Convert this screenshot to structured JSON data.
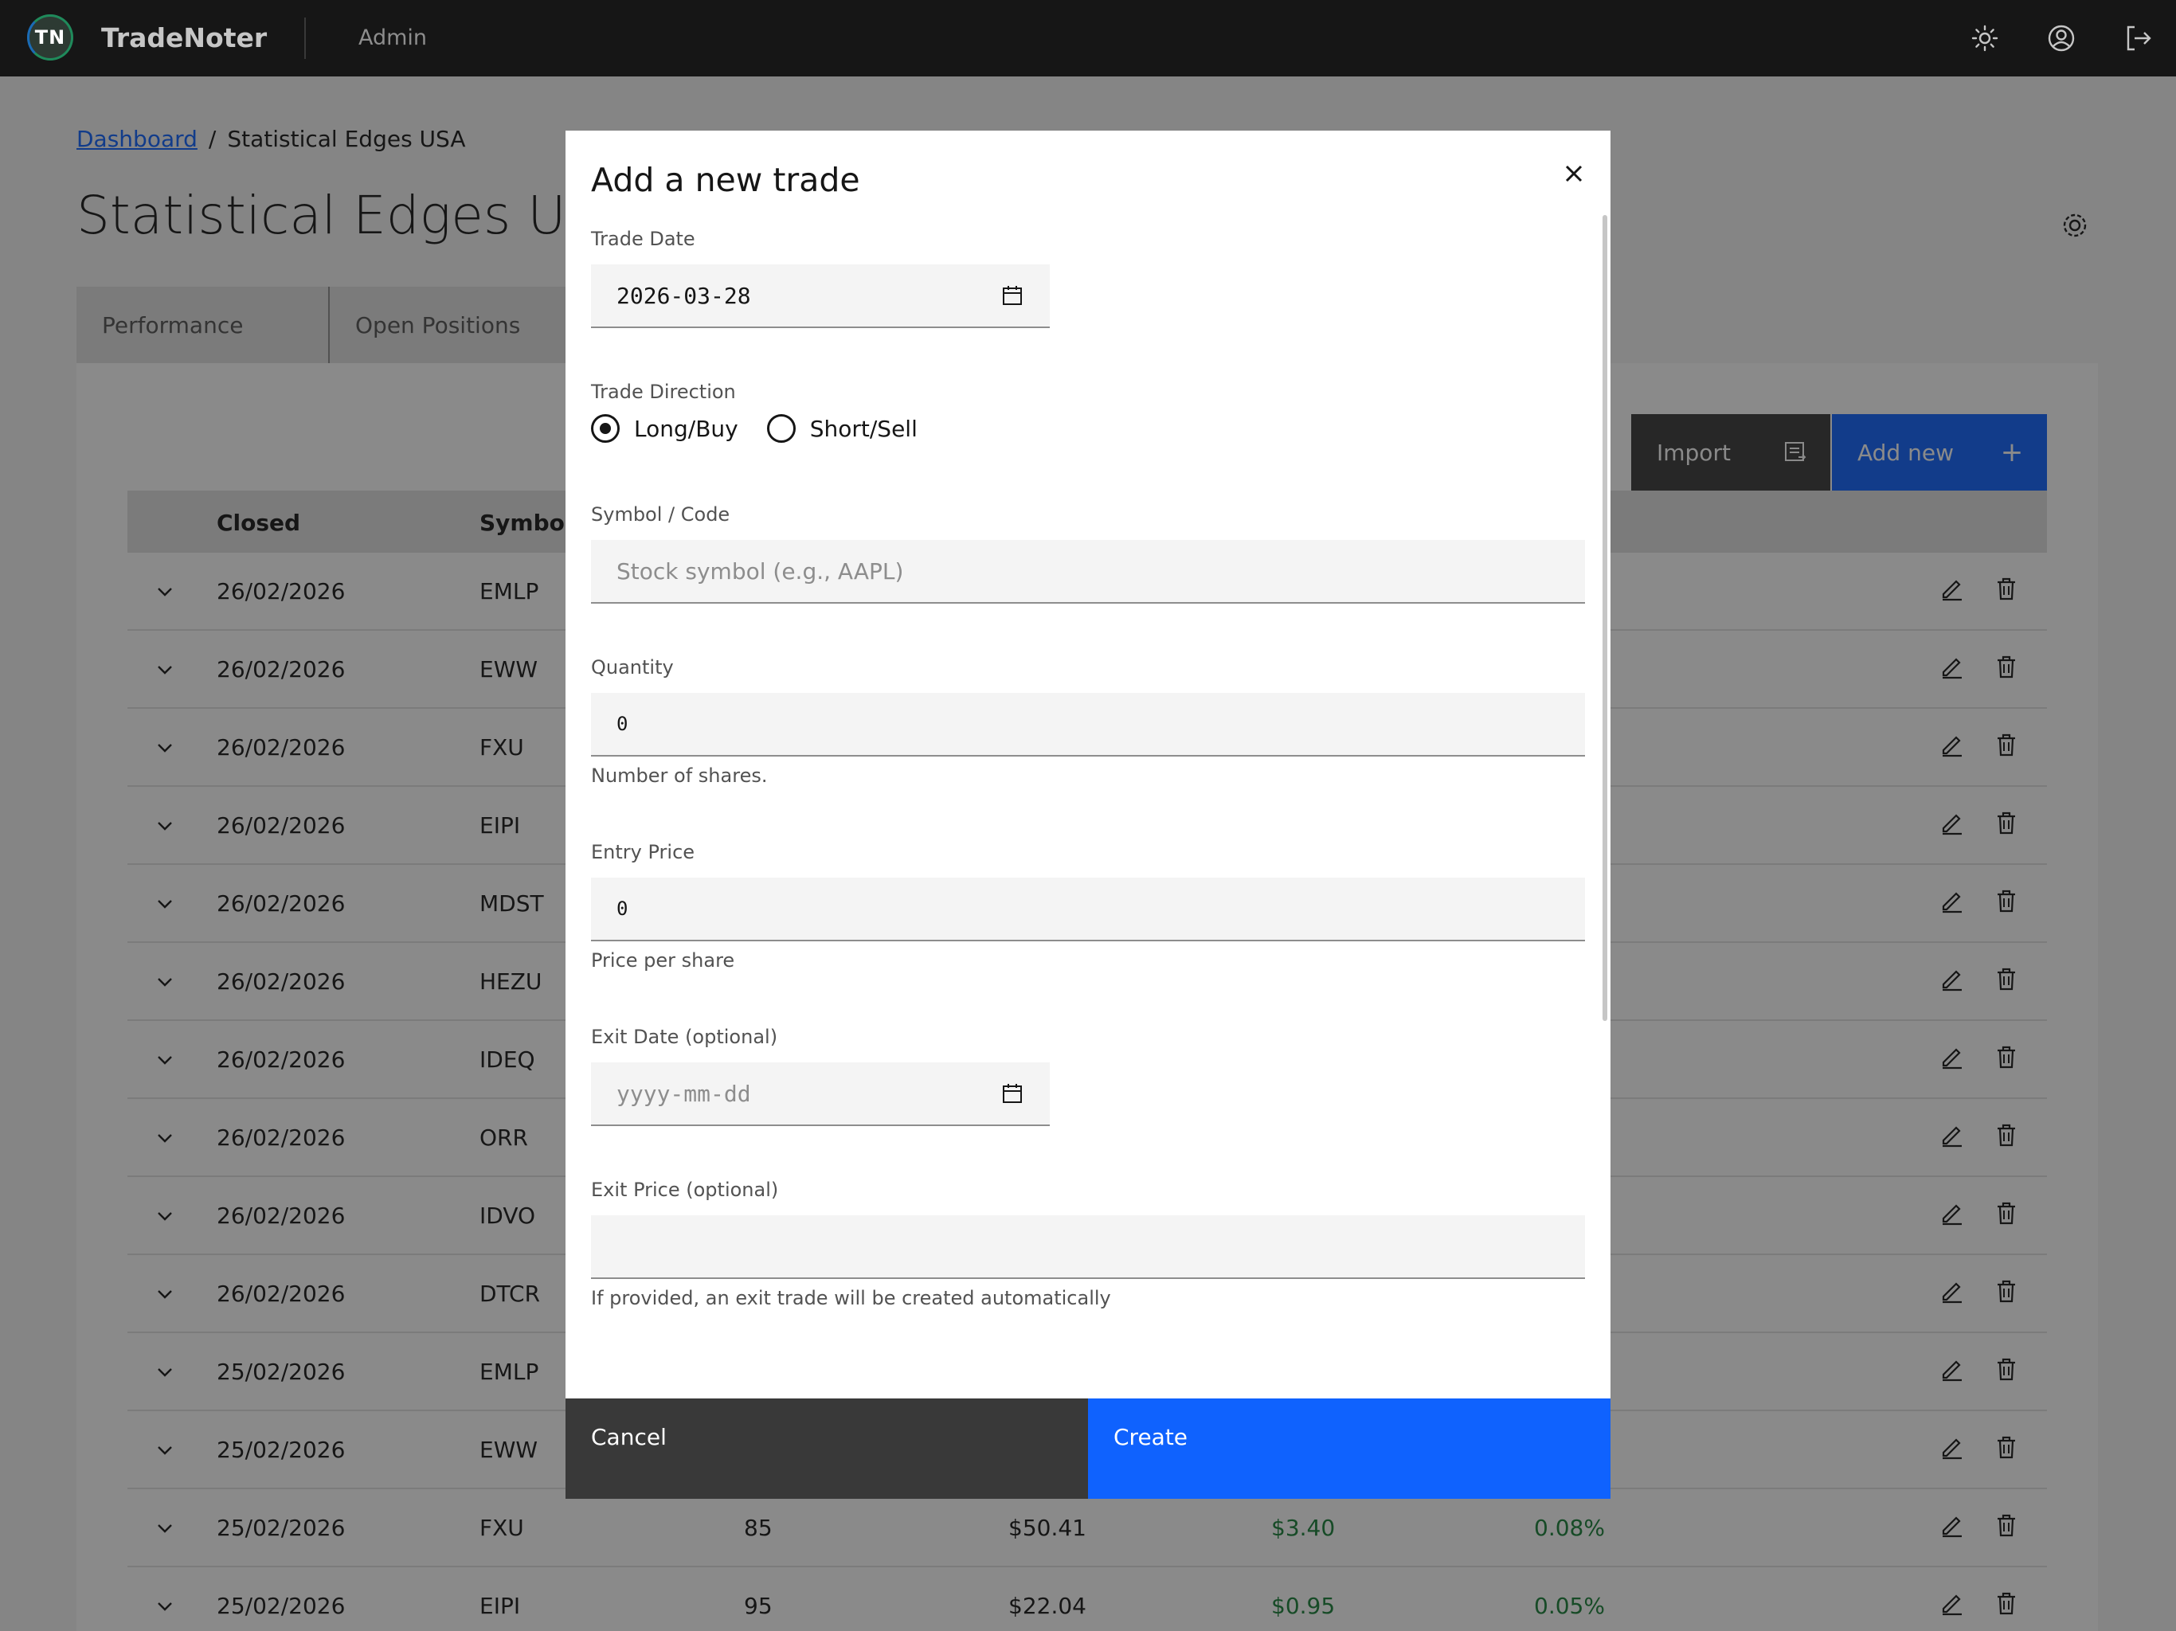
{
  "header": {
    "logo_text": "TN",
    "brand": "TradeNoter",
    "user_role": "Admin",
    "icons": [
      "sun-icon",
      "user-avatar-icon",
      "logout-icon"
    ]
  },
  "breadcrumb": {
    "parent": "Dashboard",
    "separator": "/",
    "current": "Statistical Edges USA"
  },
  "page": {
    "title": "Statistical Edges USA",
    "tabs": [
      {
        "label": "Performance"
      },
      {
        "label": "Open Positions"
      }
    ],
    "import_label": "Import",
    "add_new_label": "Add new",
    "add_new_icon": "+"
  },
  "table": {
    "columns": [
      "Closed",
      "Symbol"
    ],
    "rows": [
      {
        "date": "26/02/2026",
        "symbol": "EMLP"
      },
      {
        "date": "26/02/2026",
        "symbol": "EWW"
      },
      {
        "date": "26/02/2026",
        "symbol": "FXU"
      },
      {
        "date": "26/02/2026",
        "symbol": "EIPI"
      },
      {
        "date": "26/02/2026",
        "symbol": "MDST"
      },
      {
        "date": "26/02/2026",
        "symbol": "HEZU"
      },
      {
        "date": "26/02/2026",
        "symbol": "IDEQ"
      },
      {
        "date": "26/02/2026",
        "symbol": "ORR"
      },
      {
        "date": "26/02/2026",
        "symbol": "IDVO"
      },
      {
        "date": "26/02/2026",
        "symbol": "DTCR"
      },
      {
        "date": "25/02/2026",
        "symbol": "EMLP"
      },
      {
        "date": "25/02/2026",
        "symbol": "EWW"
      },
      {
        "date": "25/02/2026",
        "symbol": "FXU",
        "qty": "85",
        "price": "$50.41",
        "pnl": "$3.40",
        "pct": "0.08%"
      },
      {
        "date": "25/02/2026",
        "symbol": "EIPI",
        "qty": "95",
        "price": "$22.04",
        "pnl": "$0.95",
        "pct": "0.05%"
      }
    ]
  },
  "modal": {
    "title": "Add a new trade",
    "trade_date": {
      "label": "Trade Date",
      "value": "2026-03-28"
    },
    "direction": {
      "label": "Trade Direction",
      "long": "Long/Buy",
      "short": "Short/Sell",
      "selected": "Long/Buy"
    },
    "symbol": {
      "label": "Symbol / Code",
      "placeholder": "Stock symbol (e.g., AAPL)"
    },
    "quantity": {
      "label": "Quantity",
      "value": "0",
      "helper": "Number of shares."
    },
    "entry_price": {
      "label": "Entry Price",
      "value": "0",
      "helper": "Price per share"
    },
    "exit_date": {
      "label": "Exit Date (optional)",
      "placeholder": "yyyy-mm-dd"
    },
    "exit_price": {
      "label": "Exit Price (optional)",
      "value": "",
      "helper": "If provided, an exit trade will be created automatically"
    },
    "cancel_label": "Cancel",
    "create_label": "Create"
  },
  "colors": {
    "primary": "#0f62fe",
    "header_bg": "#161616",
    "positive": "#198038",
    "secondary_btn": "#393939"
  }
}
